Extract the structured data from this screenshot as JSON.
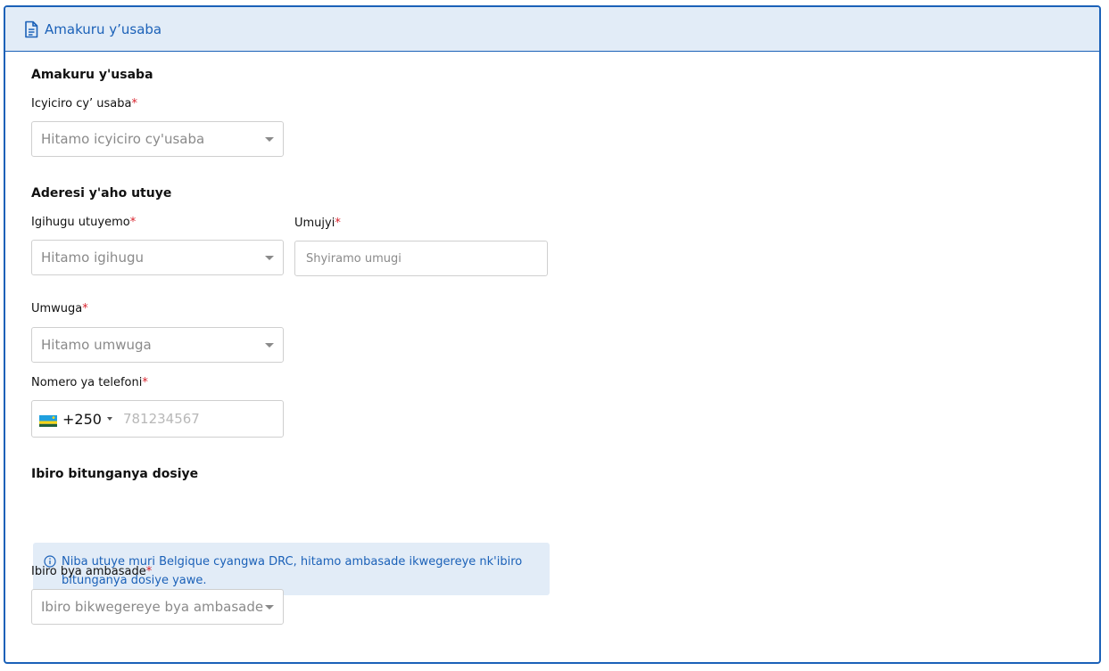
{
  "card": {
    "title": "Amakuru y’usaba",
    "icon": "document-icon"
  },
  "sections": {
    "applicant": "Amakuru y'usaba",
    "address": "Aderesi y'aho utuye",
    "office": "Ibiro bitunganya dosiye"
  },
  "fields": {
    "category": {
      "label": "Icyiciro cy’ usaba",
      "required": "*",
      "placeholder": "Hitamo icyiciro cy'usaba"
    },
    "country": {
      "label": "Igihugu utuyemo",
      "required": "*",
      "placeholder": "Hitamo igihugu"
    },
    "city": {
      "label": "Umujyi",
      "required": "*",
      "placeholder": "Shyiramo umugi"
    },
    "profession": {
      "label": "Umwuga",
      "required": "*",
      "placeholder": "Hitamo umwuga"
    },
    "phone": {
      "label": "Nomero ya telefoni",
      "required": "*",
      "dial_code": "+250",
      "placeholder": "781234567",
      "flag_icon": "rwanda-flag-icon"
    },
    "embassy": {
      "label": "Ibiro bya ambasade",
      "required": "*",
      "placeholder": "Ibiro bikwegereye bya ambasade"
    }
  },
  "info": {
    "text": "Niba utuye muri Belgique cyangwa DRC, hitamo ambasade ikwegereye nk'ibiro bitunganya dosiye yawe."
  },
  "colors": {
    "accent": "#1b61b8",
    "header_bg": "#e2ecf7",
    "required": "#d9232d",
    "border": "#cfcfcf",
    "placeholder": "#8a8a8a"
  }
}
